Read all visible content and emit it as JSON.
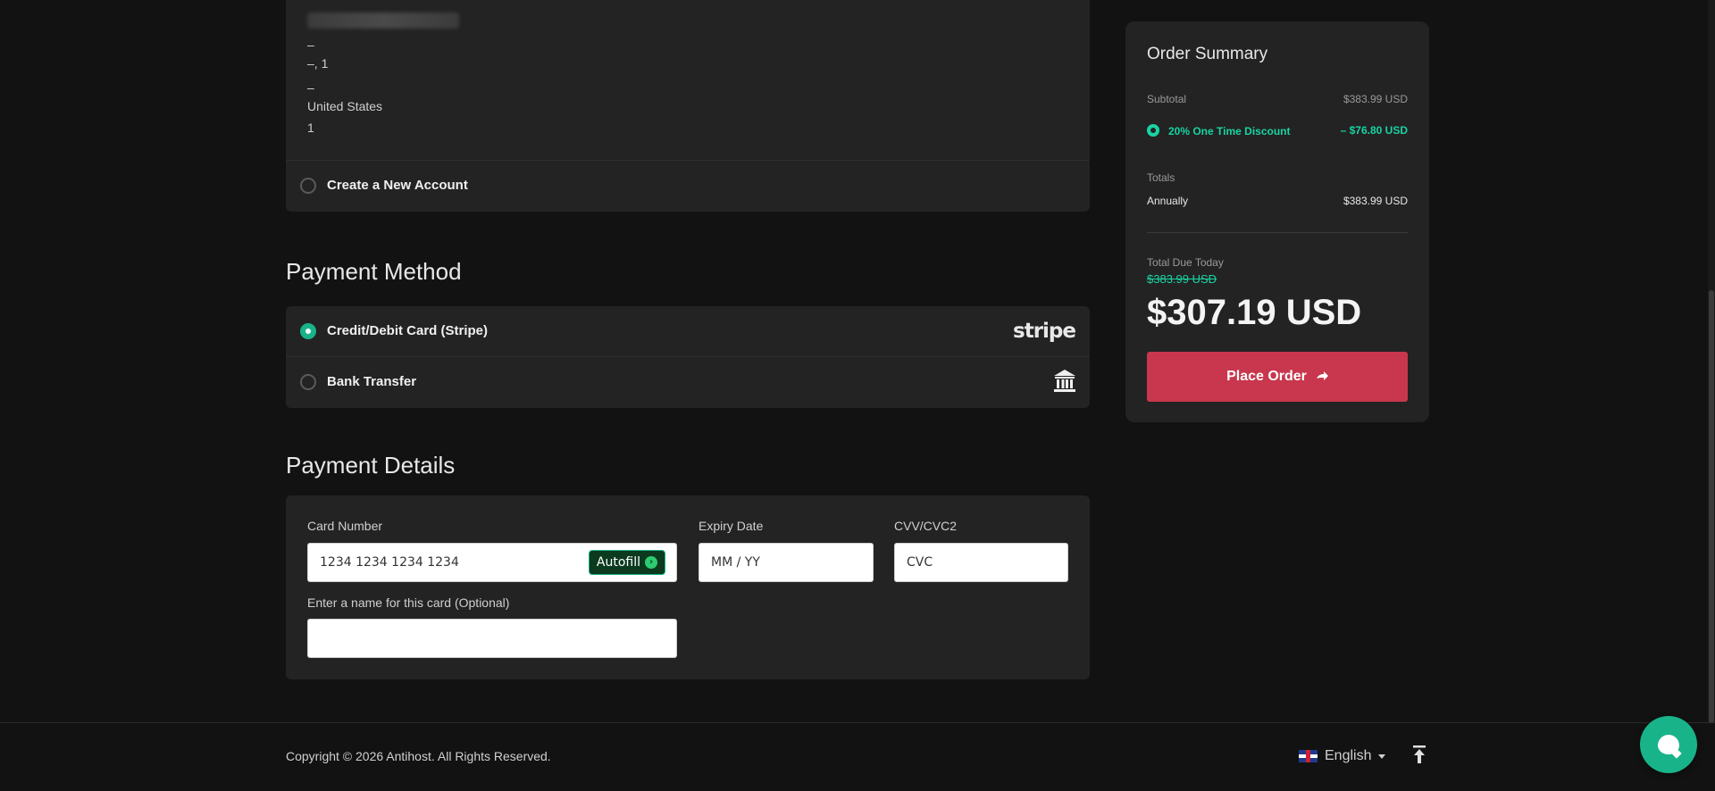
{
  "account": {
    "address_lines": [
      "–",
      "–, 1",
      "–",
      "United States",
      "1"
    ],
    "create_account_label": "Create a New Account"
  },
  "payment_method": {
    "title": "Payment Method",
    "options": [
      {
        "label": "Credit/Debit Card (Stripe)",
        "selected": true,
        "icon": "stripe-logo",
        "logo_text": "stripe"
      },
      {
        "label": "Bank Transfer",
        "selected": false,
        "icon": "bank-icon"
      }
    ]
  },
  "payment_details": {
    "title": "Payment Details",
    "card_number_label": "Card Number",
    "card_number_placeholder": "1234 1234 1234 1234",
    "autofill_label": "Autofill",
    "expiry_label": "Expiry Date",
    "expiry_placeholder": "MM / YY",
    "cvv_label": "CVV/CVC2",
    "cvv_placeholder": "CVC",
    "card_name_label": "Enter a name for this card (Optional)",
    "card_name_value": ""
  },
  "order_summary": {
    "title": "Order Summary",
    "subtotal_label": "Subtotal",
    "subtotal_value": "$383.99 USD",
    "discount_label": "20% One Time Discount",
    "discount_value": "– $76.80 USD",
    "totals_label": "Totals",
    "annually_label": "Annually",
    "annually_value": "$383.99 USD",
    "due_today_label": "Total Due Today",
    "original_price": "$383.99 USD",
    "total_due": "$307.19 USD",
    "place_order_label": "Place Order"
  },
  "footer": {
    "copyright": "Copyright © 2026 Antihost. All Rights Reserved.",
    "language": "English"
  },
  "colors": {
    "accent": "#19b38a",
    "discount": "#19d3a2",
    "place_order": "#c8374d",
    "card_bg": "#232323",
    "page_bg": "#121212"
  }
}
